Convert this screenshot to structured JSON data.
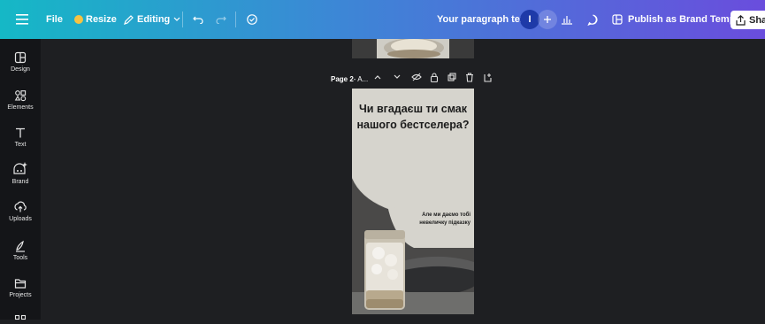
{
  "toolbar": {
    "file_label": "File",
    "resize_label": "Resize",
    "editing_label": "Editing",
    "doc_title": "Your paragraph text",
    "avatar_letter": "I",
    "publish_label": "Publish as Brand Template",
    "share_label": "Share",
    "gradient_colors": [
      "#15b8c6",
      "#3d86d6",
      "#6a4ddd"
    ]
  },
  "sidebar": {
    "items": [
      {
        "label": "Design",
        "icon": "design-icon"
      },
      {
        "label": "Elements",
        "icon": "elements-icon"
      },
      {
        "label": "Text",
        "icon": "text-icon"
      },
      {
        "label": "Brand",
        "icon": "brand-icon"
      },
      {
        "label": "Uploads",
        "icon": "uploads-icon"
      },
      {
        "label": "Tools",
        "icon": "tools-icon"
      },
      {
        "label": "Projects",
        "icon": "projects-icon"
      }
    ]
  },
  "page_bar": {
    "label_bold": "Page 2",
    "label_rest": " - A..."
  },
  "page2": {
    "title_line1": "Чи вгадаєш ти смак",
    "title_line2": "нашого бестселера?",
    "subtitle_line1": "Але ми даємо тобі",
    "subtitle_line2": "невеличку підказку"
  }
}
